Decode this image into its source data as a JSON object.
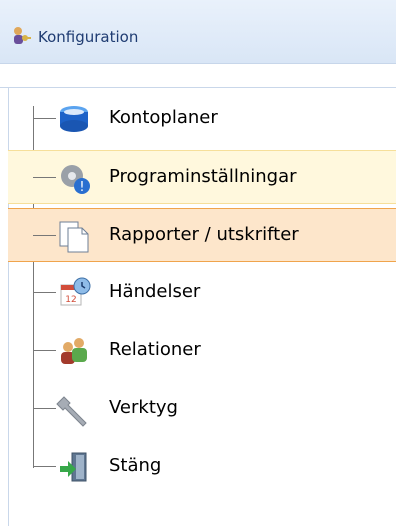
{
  "header": {
    "title": "Konfiguration",
    "icon": "key-person-icon"
  },
  "tree": {
    "items": [
      {
        "label": "Kontoplaner",
        "icon": "database-icon",
        "state": "normal"
      },
      {
        "label": "Programinställningar",
        "icon": "settings-gear-icon",
        "state": "hover"
      },
      {
        "label": "Rapporter / utskrifter",
        "icon": "documents-icon",
        "state": "selected"
      },
      {
        "label": "Händelser",
        "icon": "calendar-clock-icon",
        "state": "normal"
      },
      {
        "label": "Relationer",
        "icon": "people-icon",
        "state": "normal"
      },
      {
        "label": "Verktyg",
        "icon": "wrench-icon",
        "state": "normal"
      },
      {
        "label": "Stäng",
        "icon": "exit-door-icon",
        "state": "normal"
      }
    ]
  },
  "colors": {
    "header_text": "#1f3c72",
    "hover_bg": "#fff8dd",
    "selected_bg": "#fde6cb",
    "selected_border": "#f0a44c"
  }
}
